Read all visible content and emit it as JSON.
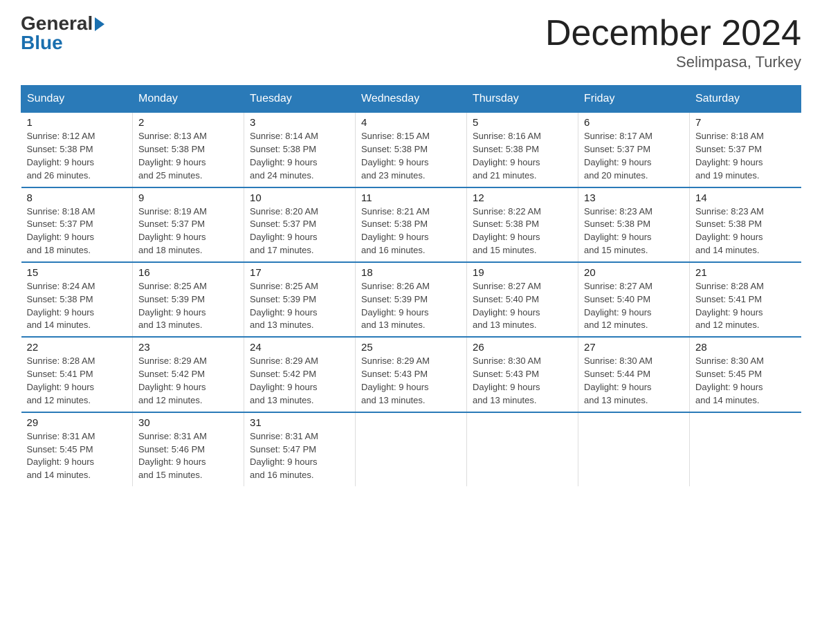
{
  "header": {
    "logo_general": "General",
    "logo_blue": "Blue",
    "title": "December 2024",
    "subtitle": "Selimpasa, Turkey"
  },
  "days_of_week": [
    "Sunday",
    "Monday",
    "Tuesday",
    "Wednesday",
    "Thursday",
    "Friday",
    "Saturday"
  ],
  "weeks": [
    [
      {
        "day": "1",
        "sunrise": "8:12 AM",
        "sunset": "5:38 PM",
        "daylight": "9 hours and 26 minutes."
      },
      {
        "day": "2",
        "sunrise": "8:13 AM",
        "sunset": "5:38 PM",
        "daylight": "9 hours and 25 minutes."
      },
      {
        "day": "3",
        "sunrise": "8:14 AM",
        "sunset": "5:38 PM",
        "daylight": "9 hours and 24 minutes."
      },
      {
        "day": "4",
        "sunrise": "8:15 AM",
        "sunset": "5:38 PM",
        "daylight": "9 hours and 23 minutes."
      },
      {
        "day": "5",
        "sunrise": "8:16 AM",
        "sunset": "5:38 PM",
        "daylight": "9 hours and 21 minutes."
      },
      {
        "day": "6",
        "sunrise": "8:17 AM",
        "sunset": "5:37 PM",
        "daylight": "9 hours and 20 minutes."
      },
      {
        "day": "7",
        "sunrise": "8:18 AM",
        "sunset": "5:37 PM",
        "daylight": "9 hours and 19 minutes."
      }
    ],
    [
      {
        "day": "8",
        "sunrise": "8:18 AM",
        "sunset": "5:37 PM",
        "daylight": "9 hours and 18 minutes."
      },
      {
        "day": "9",
        "sunrise": "8:19 AM",
        "sunset": "5:37 PM",
        "daylight": "9 hours and 18 minutes."
      },
      {
        "day": "10",
        "sunrise": "8:20 AM",
        "sunset": "5:37 PM",
        "daylight": "9 hours and 17 minutes."
      },
      {
        "day": "11",
        "sunrise": "8:21 AM",
        "sunset": "5:38 PM",
        "daylight": "9 hours and 16 minutes."
      },
      {
        "day": "12",
        "sunrise": "8:22 AM",
        "sunset": "5:38 PM",
        "daylight": "9 hours and 15 minutes."
      },
      {
        "day": "13",
        "sunrise": "8:23 AM",
        "sunset": "5:38 PM",
        "daylight": "9 hours and 15 minutes."
      },
      {
        "day": "14",
        "sunrise": "8:23 AM",
        "sunset": "5:38 PM",
        "daylight": "9 hours and 14 minutes."
      }
    ],
    [
      {
        "day": "15",
        "sunrise": "8:24 AM",
        "sunset": "5:38 PM",
        "daylight": "9 hours and 14 minutes."
      },
      {
        "day": "16",
        "sunrise": "8:25 AM",
        "sunset": "5:39 PM",
        "daylight": "9 hours and 13 minutes."
      },
      {
        "day": "17",
        "sunrise": "8:25 AM",
        "sunset": "5:39 PM",
        "daylight": "9 hours and 13 minutes."
      },
      {
        "day": "18",
        "sunrise": "8:26 AM",
        "sunset": "5:39 PM",
        "daylight": "9 hours and 13 minutes."
      },
      {
        "day": "19",
        "sunrise": "8:27 AM",
        "sunset": "5:40 PM",
        "daylight": "9 hours and 13 minutes."
      },
      {
        "day": "20",
        "sunrise": "8:27 AM",
        "sunset": "5:40 PM",
        "daylight": "9 hours and 12 minutes."
      },
      {
        "day": "21",
        "sunrise": "8:28 AM",
        "sunset": "5:41 PM",
        "daylight": "9 hours and 12 minutes."
      }
    ],
    [
      {
        "day": "22",
        "sunrise": "8:28 AM",
        "sunset": "5:41 PM",
        "daylight": "9 hours and 12 minutes."
      },
      {
        "day": "23",
        "sunrise": "8:29 AM",
        "sunset": "5:42 PM",
        "daylight": "9 hours and 12 minutes."
      },
      {
        "day": "24",
        "sunrise": "8:29 AM",
        "sunset": "5:42 PM",
        "daylight": "9 hours and 13 minutes."
      },
      {
        "day": "25",
        "sunrise": "8:29 AM",
        "sunset": "5:43 PM",
        "daylight": "9 hours and 13 minutes."
      },
      {
        "day": "26",
        "sunrise": "8:30 AM",
        "sunset": "5:43 PM",
        "daylight": "9 hours and 13 minutes."
      },
      {
        "day": "27",
        "sunrise": "8:30 AM",
        "sunset": "5:44 PM",
        "daylight": "9 hours and 13 minutes."
      },
      {
        "day": "28",
        "sunrise": "8:30 AM",
        "sunset": "5:45 PM",
        "daylight": "9 hours and 14 minutes."
      }
    ],
    [
      {
        "day": "29",
        "sunrise": "8:31 AM",
        "sunset": "5:45 PM",
        "daylight": "9 hours and 14 minutes."
      },
      {
        "day": "30",
        "sunrise": "8:31 AM",
        "sunset": "5:46 PM",
        "daylight": "9 hours and 15 minutes."
      },
      {
        "day": "31",
        "sunrise": "8:31 AM",
        "sunset": "5:47 PM",
        "daylight": "9 hours and 16 minutes."
      },
      null,
      null,
      null,
      null
    ]
  ],
  "labels": {
    "sunrise": "Sunrise:",
    "sunset": "Sunset:",
    "daylight": "Daylight:"
  }
}
